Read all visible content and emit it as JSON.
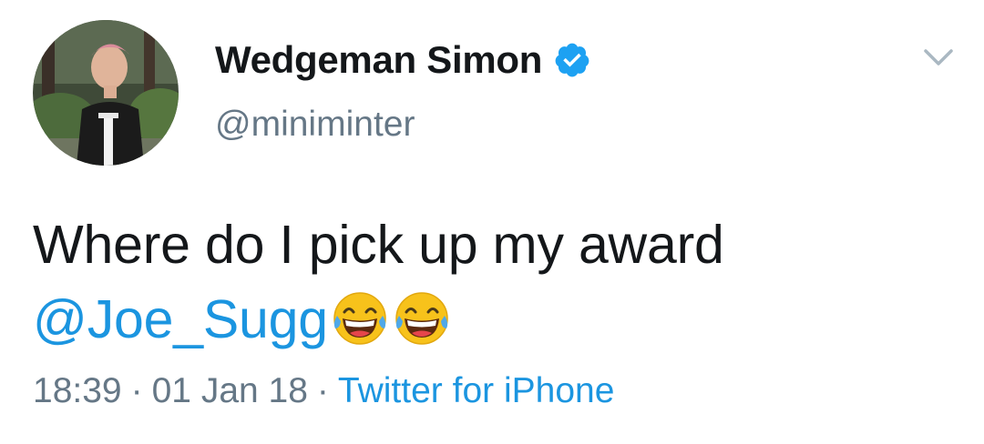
{
  "user": {
    "display_name": "Wedgeman Simon",
    "handle": "@miniminter",
    "verified": true,
    "verified_icon": "verified-badge-icon"
  },
  "tweet": {
    "text_line1": "Where do I pick up my award",
    "mention": "@Joe_Sugg",
    "emojis": [
      "face-with-tears-of-joy-icon",
      "face-with-tears-of-joy-icon"
    ]
  },
  "meta": {
    "time": "18:39",
    "separator": "·",
    "date": "01 Jan 18",
    "source": "Twitter for iPhone"
  },
  "colors": {
    "link": "#1b95e0",
    "text": "#14171a",
    "secondary": "#657786",
    "verified": "#1da1f2"
  }
}
